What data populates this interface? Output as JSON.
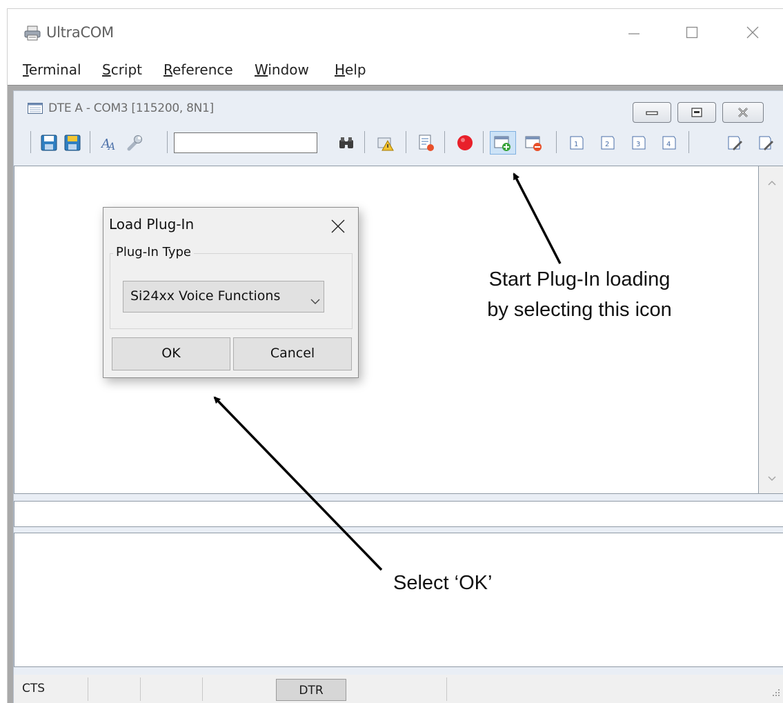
{
  "window": {
    "title": "UltraCOM",
    "menu": [
      {
        "label": "Terminal",
        "mnemonic": "T",
        "rest": "erminal"
      },
      {
        "label": "Script",
        "mnemonic": "S",
        "rest": "cript"
      },
      {
        "label": "Reference",
        "mnemonic": "R",
        "rest": "eference"
      },
      {
        "label": "Window",
        "mnemonic": "W",
        "rest": "indow"
      },
      {
        "label": "Help",
        "mnemonic": "H",
        "rest": "elp"
      }
    ]
  },
  "child_window": {
    "title": "DTE A - COM3 [115200, 8N1]",
    "search_value": ""
  },
  "toolbar_icons": [
    "save-icon",
    "save-as-icon",
    "font-icon",
    "wrench-icon",
    "binoculars-icon",
    "warning-icon",
    "log-icon",
    "record-icon",
    "load-plugin-icon",
    "unload-plugin-icon",
    "macro-1-icon",
    "macro-2-icon",
    "macro-3-icon",
    "macro-4-icon",
    "edit-script-1-icon",
    "edit-script-2-icon"
  ],
  "status_bar": {
    "cts": "CTS",
    "dtr": "DTR"
  },
  "dialog": {
    "title": "Load Plug-In",
    "group_label": "Plug-In Type",
    "selected_plugin": "Si24xx Voice Functions",
    "ok_label": "OK",
    "cancel_label": "Cancel"
  },
  "annotations": {
    "start_line1": "Start Plug-In loading",
    "start_line2": "by selecting this icon",
    "select_ok": "Select ‘OK’"
  },
  "colors": {
    "record": "#e8202a",
    "toolbar_active": "#cde3f7",
    "save_blue": "#2f7fc1",
    "save_yellow": "#f3c634"
  }
}
